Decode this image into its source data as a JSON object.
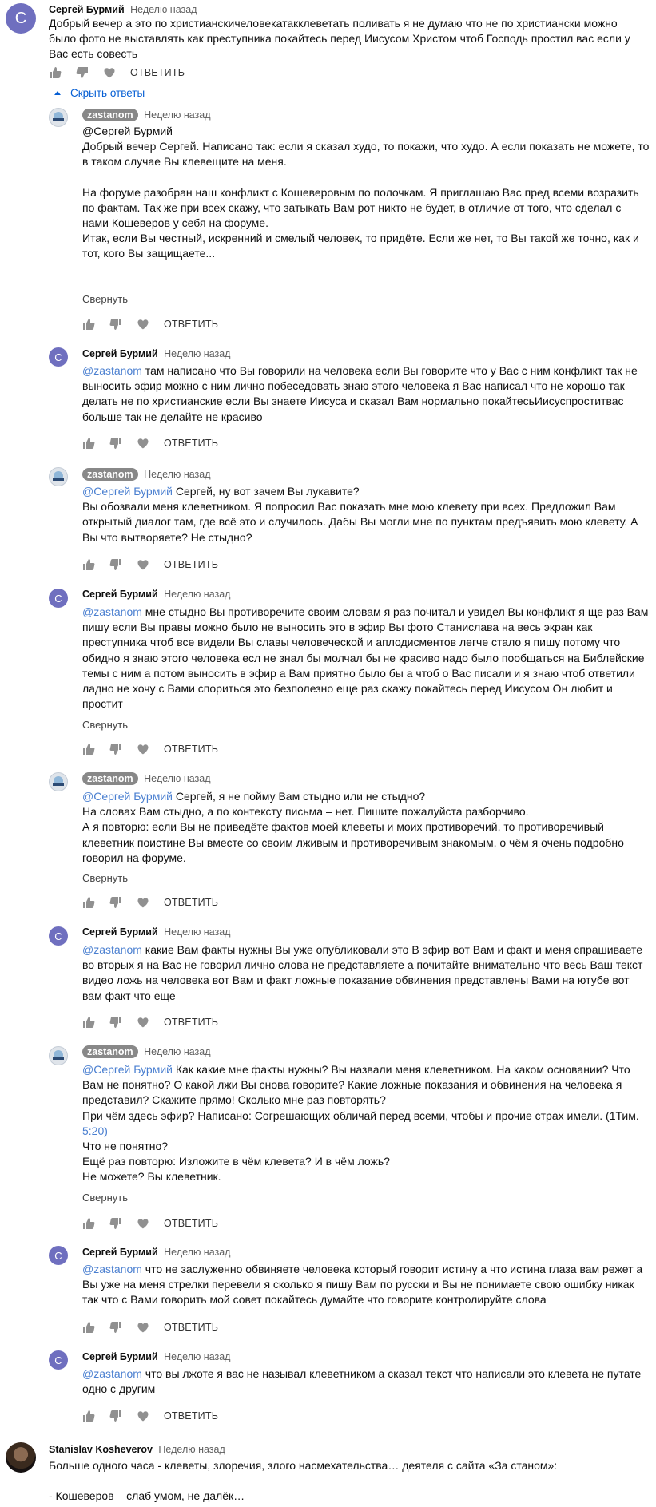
{
  "hide_replies": "Скрыть ответы",
  "reply_label": "ОТВЕТИТЬ",
  "collapse_label": "Свернуть",
  "comments": [
    {
      "avatar_letter": "С",
      "author": "Сергей Бурмий",
      "time": "Неделю назад",
      "lines": [
        "Добрый вечер а это по христианскичеловекатакклеветать поливать я не думаю что не по христиански можно",
        "было фото не выставлять как преступника покайтесь перед Иисусом Христом чтоб Господь простил вас если у",
        "Вас есть совесть"
      ]
    },
    {
      "author": "zastanom",
      "time": "Неделю назад",
      "lines": [
        "@Сергей Бурмий",
        "Добрый вечер Сергей. Написано так: если я сказал худо, то покажи, что худо. А если показать не можете, то",
        "в таком случае Вы клевещите на меня.",
        "",
        "На форуме разобран наш конфликт с Кошеверовым по полочкам. Я приглашаю Вас пред всеми возразить",
        "по фактам. Так же при всех скажу, что затыкать Вам рот никто не будет, в отличие от того, что сделал с",
        "нами Кошеверов у себя на форуме.",
        "Итак, если Вы честный, искренний и смелый человек, то придёте. Если же нет, то Вы такой же точно, как и",
        "тот, кого Вы защищаете..."
      ]
    },
    {
      "avatar_letter": "С",
      "author": "Сергей Бурмий",
      "time": "Неделю назад",
      "mention": "@zastanom",
      "lines": [
        " там написано что Вы говорили на человека если Вы говорите что у Вас с ним конфликт так не",
        "выносить эфир можно с ним лично побеседовать знаю этого человека я Вас написал что не хорошо так",
        "делать не по христианские если Вы знаете Иисуса и сказал Вам нормально покайтесьИисуспроститвас",
        "больше так не делайте не красиво"
      ]
    },
    {
      "author": "zastanom",
      "time": "Неделю назад",
      "mention": "@Сергей Бурмий",
      "lines": [
        " Сергей, ну вот зачем Вы лукавите?",
        "Вы обозвали меня клеветником. Я попросил Вас показать мне мою клевету при всех. Предложил Вам",
        "открытый диалог там, где всё это и случилось. Дабы Вы могли мне по пунктам предъявить мою клевету. А",
        "Вы что вытворяете? Не стыдно?"
      ]
    },
    {
      "avatar_letter": "С",
      "author": "Сергей Бурмий",
      "time": "Неделю назад",
      "mention": "@zastanom",
      "lines": [
        " мне стыдно Вы противоречите своим словам я раз почитал и увидел Вы конфликт я ще раз Вам",
        "пишу если Вы правы можно было не выносить это в эфир Вы фото Станислава на весь экран как",
        "преступника чтоб все видели Вы славы человеческой и аплодисментов легче стало я пишу потому что",
        "обидно я знаю этого человека есл не знал бы молчал бы не красиво надо было пообщаться на Библейские",
        "темы с ним а потом выносить в эфир а Вам приятно было бы а чтоб о Вас писали и я знаю чтоб ответили",
        "ладно не хочу с Вами спориться это безполезно еще раз скажу покайтесь перед Иисусом Он любит и",
        "простит"
      ]
    },
    {
      "author": "zastanom",
      "time": "Неделю назад",
      "mention": "@Сергей Бурмий",
      "lines": [
        " Сергей, я не пойму Вам стыдно или не стыдно?",
        "На словах Вам стыдно, а по контексту письма – нет. Пишите пожалуйста разборчиво.",
        "А я повторю: если Вы не приведёте фактов моей клеветы и моих противоречий, то противоречивый",
        "клеветник поистине Вы вместе со своим лживым и противоречивым знакомым, о чём я очень подробно",
        "говорил на форуме."
      ]
    },
    {
      "avatar_letter": "С",
      "author": "Сергей Бурмий",
      "time": "Неделю назад",
      "mention": "@zastanom",
      "lines": [
        " какие Вам факты нужны Вы уже опубликовали это  В эфир вот Вам и факт и меня спрашиваете",
        "во вторых я на Вас не говорил лично слова не представляете а почитайте внимательно что весь Ваш текст",
        "видео ложь на человека вот Вам и факт ложные показание обвинения представлены Вами на ютубе вот",
        "вам факт что еще"
      ]
    },
    {
      "author": "zastanom",
      "time": "Неделю назад",
      "mention": "@Сергей Бурмий",
      "lines": [
        " Как какие мне факты нужны? Вы назвали меня клеветником. На каком основании? Что",
        "Вам не понятно? О какой лжи Вы снова говорите? Какие ложные показания и обвинения на человека я",
        "представил? Скажите прямо! Сколько мне раз повторять?",
        "При чём здесь эфир? Написано: Согрешающих обличай перед всеми, чтобы и прочие страх имели. (1Тим.",
        "5:20)",
        "Что не понятно?",
        "Ещё раз повторю: Изложите в чём клевета? И в чём ложь?",
        "Не можете? Вы клеветник."
      ],
      "link_text": "5:20"
    },
    {
      "avatar_letter": "С",
      "author": "Сергей Бурмий",
      "time": "Неделю назад",
      "mention": "@zastanom",
      "lines": [
        " что не заслуженно обвиняете человека который говорит истину а что истина глаза вам режет а",
        "Вы уже на меня стрелки перевели я сколько я пишу Вам по русски и Вы не понимаете свою ошибку никак",
        "так что с Вами говорить мой совет покайтесь думайте что говорите контролируйте слова"
      ]
    },
    {
      "avatar_letter": "С",
      "author": "Сергей Бурмий",
      "time": "Неделю назад",
      "mention": "@zastanom",
      "lines": [
        " что вы лжоте я вас не называл клеветником а сказал текст что написали это клевета не путате",
        "одно с другим"
      ]
    },
    {
      "author": "Stanislav Kosheverov",
      "time": "Неделю назад",
      "lines": [
        "Больше одного часа - клеветы, злоречия, злого насмехательства… деятеля с сайта «За станом»:",
        "",
        "- Кошеверов – слаб умом, не далёк…"
      ]
    }
  ]
}
